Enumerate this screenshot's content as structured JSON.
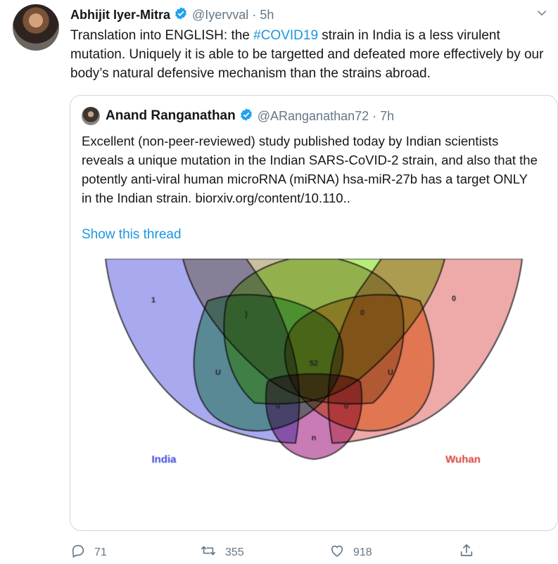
{
  "tweet": {
    "author_name": "Abhijit Iyer-Mitra",
    "handle": "@Iyervval",
    "separator": "·",
    "time": "5h",
    "text_before": "Translation into ENGLISH: the ",
    "hashtag": "#COVID19",
    "text_after": " strain in India is a less virulent mutation. Uniquely it is able to be targetted and defeated more effectively by our body’s natural defensive mechanism than the strains abroad."
  },
  "quoted_tweet": {
    "author_name": "Anand Ranganathan",
    "handle": "@ARanganathan72",
    "separator": "·",
    "time": "7h",
    "text": "Excellent (non-peer-reviewed) study published today by Indian scientists reveals a unique mutation in the Indian SARS-CoVID-2 strain, and also that the potently anti-viral human microRNA (miRNA) hsa-miR-27b has a target ONLY in the Indian strain. biorxiv.org/content/10.110..",
    "show_thread": "Show this thread",
    "venn": {
      "labels": {
        "india": "India",
        "wuhan": "Wuhan"
      },
      "regions": {
        "india_only": "1",
        "upper_left": ")",
        "upper_right": "0",
        "right_only": "0",
        "left_mid": "U",
        "center": "52",
        "right_mid": "U",
        "lower_left": "0",
        "lower_right": "0",
        "bottom": "n"
      },
      "colors": {
        "india": "#a9a9ef",
        "wuhan": "#eea9a9",
        "top_left": "#cabfa1",
        "top_green": "#b8ec79"
      }
    }
  },
  "actions": {
    "reply_count": "71",
    "retweet_count": "355",
    "like_count": "918"
  }
}
